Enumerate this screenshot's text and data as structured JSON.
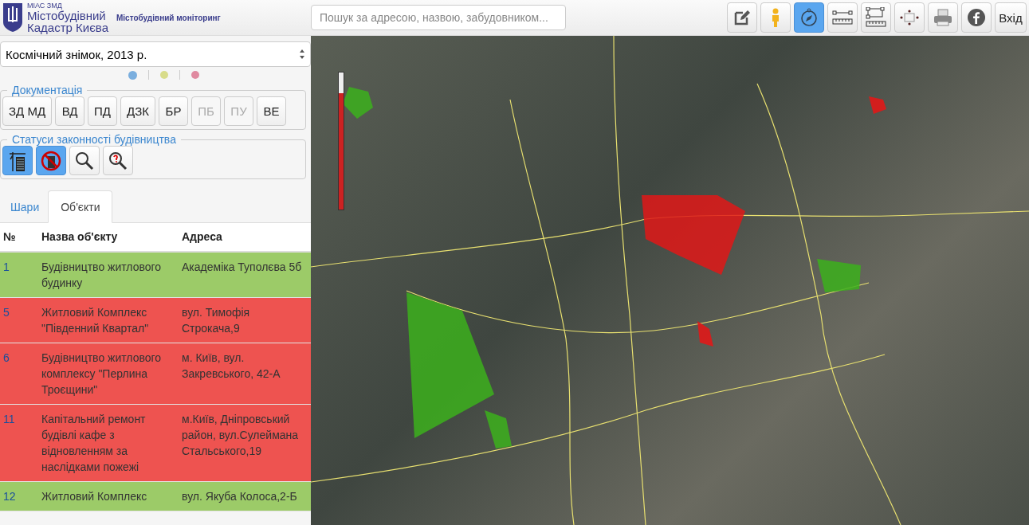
{
  "header": {
    "org": "МІАС ЗМД",
    "title_line_1": "Містобудівний",
    "title_line_2": "Кадастр Києва",
    "subtitle": "Містобудівний моніторинг"
  },
  "search": {
    "placeholder": "Пошук за адресою, назвою, забудовником..."
  },
  "toolbar": [
    {
      "kind": "edit",
      "selected": false
    },
    {
      "kind": "person",
      "selected": false
    },
    {
      "kind": "compass",
      "selected": true
    },
    {
      "kind": "ruler",
      "selected": false
    },
    {
      "kind": "area",
      "selected": false
    },
    {
      "kind": "center",
      "selected": false
    },
    {
      "kind": "print",
      "selected": false
    },
    {
      "kind": "facebook",
      "selected": false
    }
  ],
  "login_button": "Вхід",
  "basemap_select": {
    "value": "Космічний знімок, 2013 р."
  },
  "basemap_dots": [
    {
      "color": "#7aaede",
      "selected": true
    },
    {
      "color": "#d8dc8a",
      "selected": false
    },
    {
      "color": "#e08aa0",
      "selected": false
    }
  ],
  "documentation": {
    "legend": "Документація",
    "buttons": [
      {
        "label": "ЗД МД",
        "disabled": false
      },
      {
        "label": "ВД",
        "disabled": false
      },
      {
        "label": "ПД",
        "disabled": false
      },
      {
        "label": "ДЗК",
        "disabled": false
      },
      {
        "label": "БР",
        "disabled": false
      },
      {
        "label": "ПБ",
        "disabled": true
      },
      {
        "label": "ПУ",
        "disabled": true
      },
      {
        "label": "ВЕ",
        "disabled": false
      }
    ]
  },
  "statuses": {
    "legend": "Статуси законності будівництва",
    "buttons": [
      {
        "kind": "building",
        "selected": true
      },
      {
        "kind": "forbidden",
        "selected": true
      },
      {
        "kind": "search",
        "selected": false
      },
      {
        "kind": "unknown",
        "selected": false
      }
    ]
  },
  "tabs": [
    {
      "label": "Шари",
      "selected": false
    },
    {
      "label": "Об'єкти",
      "selected": true
    }
  ],
  "table": {
    "columns": [
      "№",
      "Назва об'єкту",
      "Адреса"
    ],
    "rows": [
      {
        "num": "1",
        "name": "Будівництво житлового будинку",
        "address": "Академіка Туполєва 5б",
        "color": "#9ccb68"
      },
      {
        "num": "5",
        "name": "Житловий Комплекс \"Південний Квартал\"",
        "address": "вул. Тимофія Строкача,9",
        "color": "#ee5350"
      },
      {
        "num": "6",
        "name": "Будівництво житлового комплексу \"Перлина Троєщини\"",
        "address": "м. Київ, вул. Закревського, 42-А",
        "color": "#ee5350"
      },
      {
        "num": "11",
        "name": "Капітальний ремонт будівлі кафе з відновленням за наслідками пожежі",
        "address": "м.Київ, Дніпровський район, вул.Сулеймана Стальського,19",
        "color": "#ee5350"
      },
      {
        "num": "12",
        "name": "Житловий Комплекс",
        "address": "вул. Якуба Колоса,2-Б",
        "color": "#9ccb68"
      }
    ]
  },
  "map": {
    "zoom_slider": {
      "level": 0.85
    }
  }
}
